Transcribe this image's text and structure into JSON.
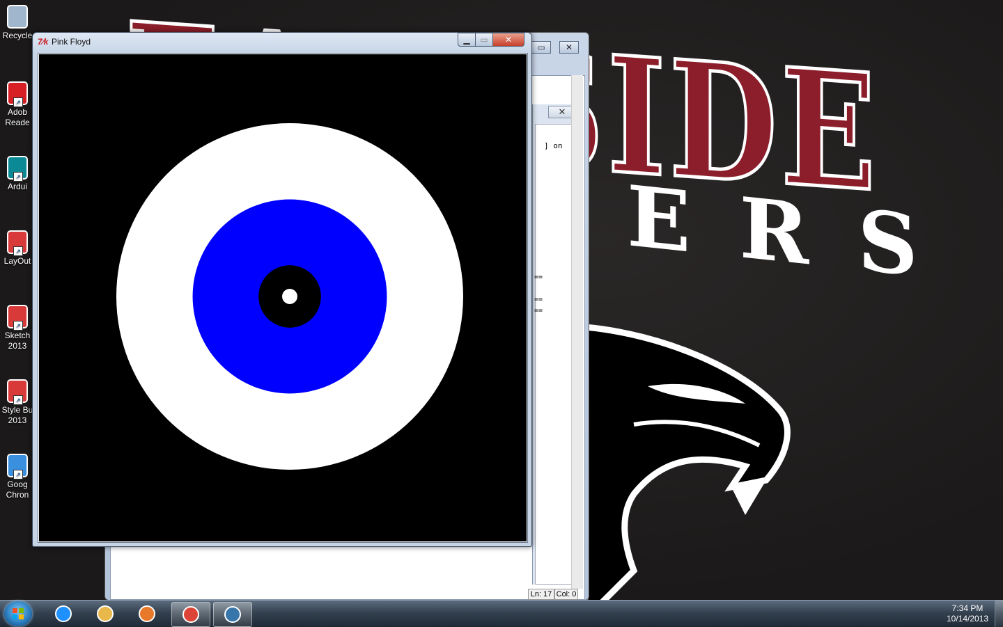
{
  "wallpaper": {
    "word_top": "EASTSIDE",
    "word_bottom": "ERS"
  },
  "desktop_icons": [
    {
      "label": "Recycle",
      "icon": "recycle-bin-icon"
    },
    {
      "label": "Adob Reade",
      "icon": "adobe-reader-icon"
    },
    {
      "label": "Ardui",
      "icon": "arduino-icon"
    },
    {
      "label": "LayOut",
      "icon": "layout-icon"
    },
    {
      "label": "Sketch 2013",
      "icon": "sketchup-icon"
    },
    {
      "label": "Style Bu 2013",
      "icon": "style-builder-icon"
    },
    {
      "label": "Goog Chron",
      "icon": "google-chrome-icon"
    }
  ],
  "idle": {
    "shell_fragment": "] on",
    "status_line": "Ln: 17",
    "status_col": "Col: 0",
    "eq_marks": "=="
  },
  "tk_window": {
    "title": "Pink Floyd",
    "icon_text": "7∕k",
    "canvas_background": "#000000",
    "rings": [
      {
        "color": "#ffffff",
        "relative_size": 1.0
      },
      {
        "color": "#0000ff",
        "relative_size": 0.56
      },
      {
        "color": "#000000",
        "relative_size": 0.18
      },
      {
        "color": "#ffffff",
        "relative_size": 0.044
      }
    ]
  },
  "taskbar": {
    "start_icon": "windows-start-icon",
    "pinned": [
      {
        "name": "internet-explorer-icon",
        "active": false
      },
      {
        "name": "file-explorer-icon",
        "active": false
      },
      {
        "name": "media-player-icon",
        "active": false
      },
      {
        "name": "google-chrome-icon",
        "active": true
      },
      {
        "name": "python-idle-icon",
        "active": true
      }
    ],
    "time": "7:34 PM",
    "date": "10/14/2013"
  },
  "colors": {
    "wallpaper_red": "#8b1e2a",
    "ring_blue": "#0000ff",
    "close_red": "#c7402a"
  }
}
